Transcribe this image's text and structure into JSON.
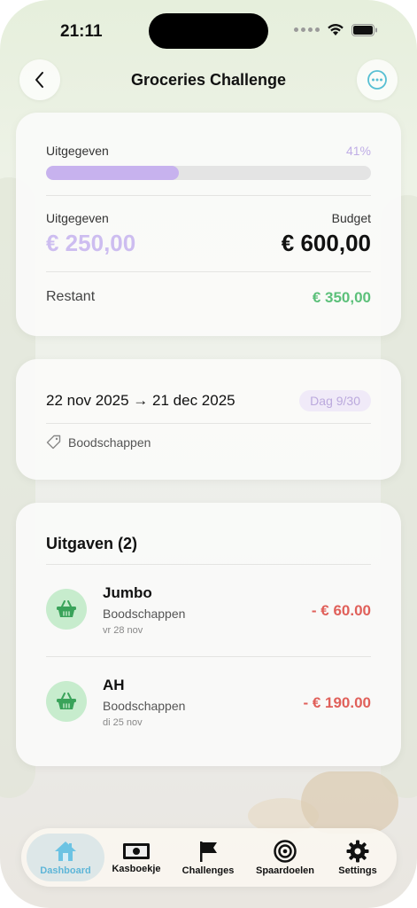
{
  "status": {
    "time": "21:11"
  },
  "header": {
    "title": "Groceries Challenge"
  },
  "progress_card": {
    "spent_label": "Uitgegeven",
    "percent_label": "41%",
    "progress": 0.41,
    "spent_caption": "Uitgegeven",
    "budget_caption": "Budget",
    "spent_value": "€ 250,00",
    "budget_value": "€ 600,00",
    "remaining_label": "Restant",
    "remaining_value": "€ 350,00"
  },
  "period_card": {
    "range": "22 nov 2025 → 21 dec 2025",
    "day_badge": "Dag 9/30",
    "category": "Boodschappen"
  },
  "expenses_card": {
    "title": "Uitgaven (2)",
    "items": [
      {
        "name": "Jumbo",
        "category": "Boodschappen",
        "date": "vr 28 nov",
        "amount": "- € 60.00"
      },
      {
        "name": "AH",
        "category": "Boodschappen",
        "date": "di 25 nov",
        "amount": "- € 190.00"
      }
    ]
  },
  "tabbar": {
    "tabs": [
      {
        "label": "Dashboard",
        "icon": "home-icon"
      },
      {
        "label": "Kasboekje",
        "icon": "banknote-icon"
      },
      {
        "label": "Challenges",
        "icon": "flag-icon"
      },
      {
        "label": "Spaardoelen",
        "icon": "target-icon"
      },
      {
        "label": "Settings",
        "icon": "gear-icon"
      }
    ]
  },
  "colors": {
    "accent_purple": "#c7b2ee",
    "green": "#5cc07a",
    "red": "#e0605a",
    "active_tab": "#5eb6d8"
  }
}
